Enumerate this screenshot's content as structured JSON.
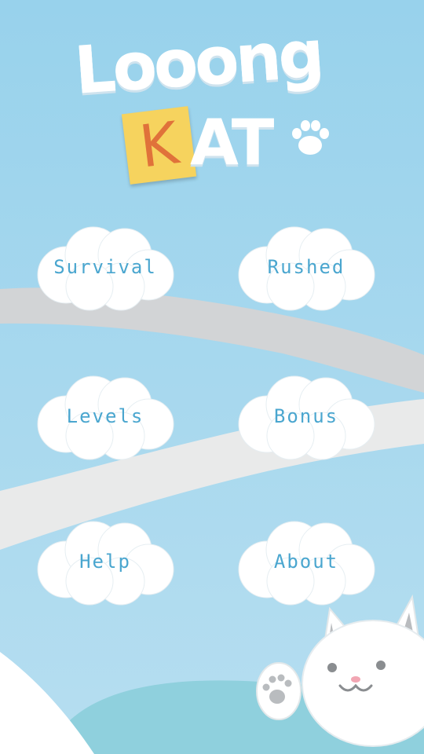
{
  "logo": {
    "word_top": "Looong",
    "letter_note": "K",
    "word_rest": "AT"
  },
  "menu": {
    "survival": "Survival",
    "rushed": "Rushed",
    "levels": "Levels",
    "bonus": "Bonus",
    "help": "Help",
    "about": "About"
  },
  "colors": {
    "sky": "#a9d8ef",
    "label": "#4aa6cf",
    "note": "#f6d35e",
    "note_letter": "#e0723a",
    "ground": "#8ecfdc"
  },
  "icons": {
    "paw": "paw-icon",
    "cat": "cat-character"
  }
}
